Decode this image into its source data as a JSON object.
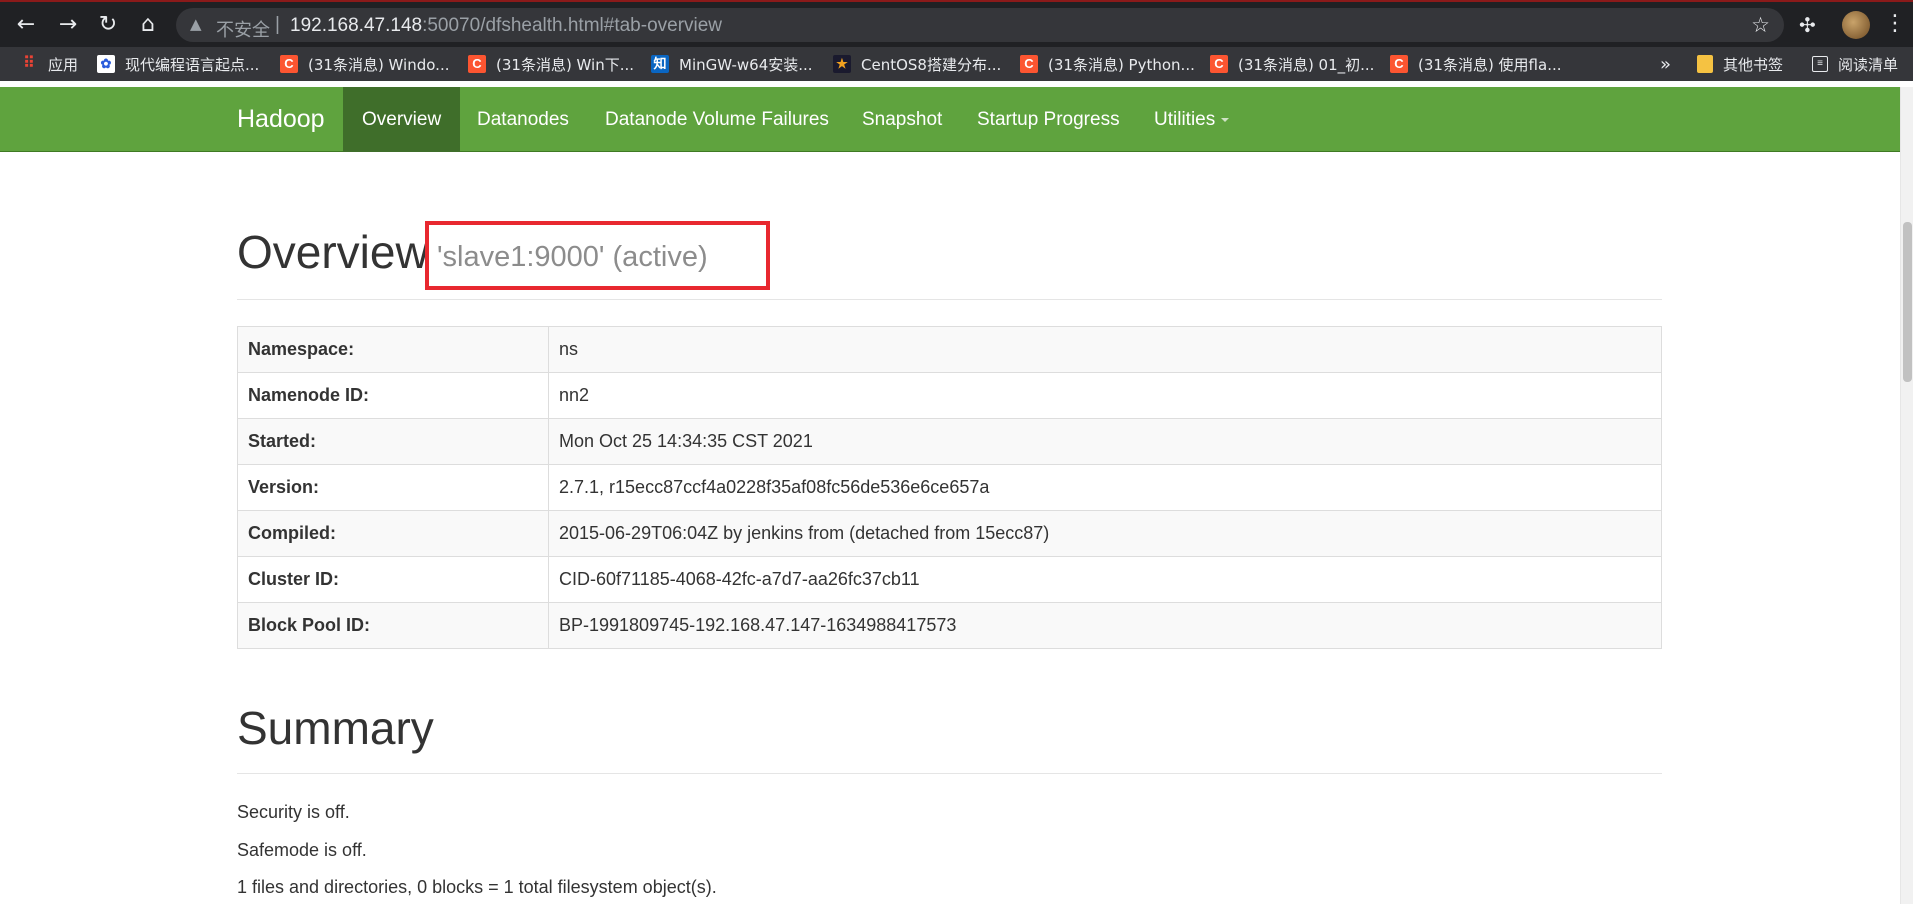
{
  "browser": {
    "security_label": "不安全",
    "url_host": "192.168.47.148",
    "url_rest": ":50070/dfshealth.html#tab-overview"
  },
  "bookmarks": {
    "items": [
      {
        "label": "应用",
        "icon": "apps-icon"
      },
      {
        "label": "现代编程语言起点...",
        "icon": "baidu-paw-icon"
      },
      {
        "label": "(31条消息) Windo...",
        "icon": "csdn-icon"
      },
      {
        "label": "(31条消息) Win下...",
        "icon": "csdn-icon"
      },
      {
        "label": "MinGW-w64安装...",
        "icon": "zhihu-icon"
      },
      {
        "label": "CentOS8搭建分布...",
        "icon": "star-icon"
      },
      {
        "label": "(31条消息) Python...",
        "icon": "csdn-icon"
      },
      {
        "label": "(31条消息) 01_初...",
        "icon": "csdn-icon"
      },
      {
        "label": "(31条消息) 使用fla...",
        "icon": "csdn-icon"
      }
    ],
    "overflow": "»",
    "other_label": "其他书签",
    "reading_list_label": "阅读清单"
  },
  "navbar": {
    "brand": "Hadoop",
    "items": [
      {
        "label": "Overview",
        "active": true
      },
      {
        "label": "Datanodes",
        "active": false
      },
      {
        "label": "Datanode Volume Failures",
        "active": false
      },
      {
        "label": "Snapshot",
        "active": false
      },
      {
        "label": "Startup Progress",
        "active": false
      },
      {
        "label": "Utilities",
        "active": false,
        "dropdown": true
      }
    ],
    "bg_color": "#5fa33e",
    "active_color": "#3f6e2a"
  },
  "overview": {
    "title": "Overview",
    "subtitle": "'slave1:9000' (active)",
    "rows": [
      {
        "key": "Namespace:",
        "value": "ns"
      },
      {
        "key": "Namenode ID:",
        "value": "nn2"
      },
      {
        "key": "Started:",
        "value": "Mon Oct 25 14:34:35 CST 2021"
      },
      {
        "key": "Version:",
        "value": "2.7.1, r15ecc87ccf4a0228f35af08fc56de536e6ce657a"
      },
      {
        "key": "Compiled:",
        "value": "2015-06-29T06:04Z by jenkins from (detached from 15ecc87)"
      },
      {
        "key": "Cluster ID:",
        "value": "CID-60f71185-4068-42fc-a7d7-aa26fc37cb11"
      },
      {
        "key": "Block Pool ID:",
        "value": "BP-1991809745-192.168.47.147-1634988417573"
      }
    ]
  },
  "summary": {
    "title": "Summary",
    "lines": [
      "Security is off.",
      "Safemode is off.",
      "1 files and directories, 0 blocks = 1 total filesystem object(s)."
    ]
  },
  "annotation": {
    "highlight_color": "#e8282f"
  }
}
